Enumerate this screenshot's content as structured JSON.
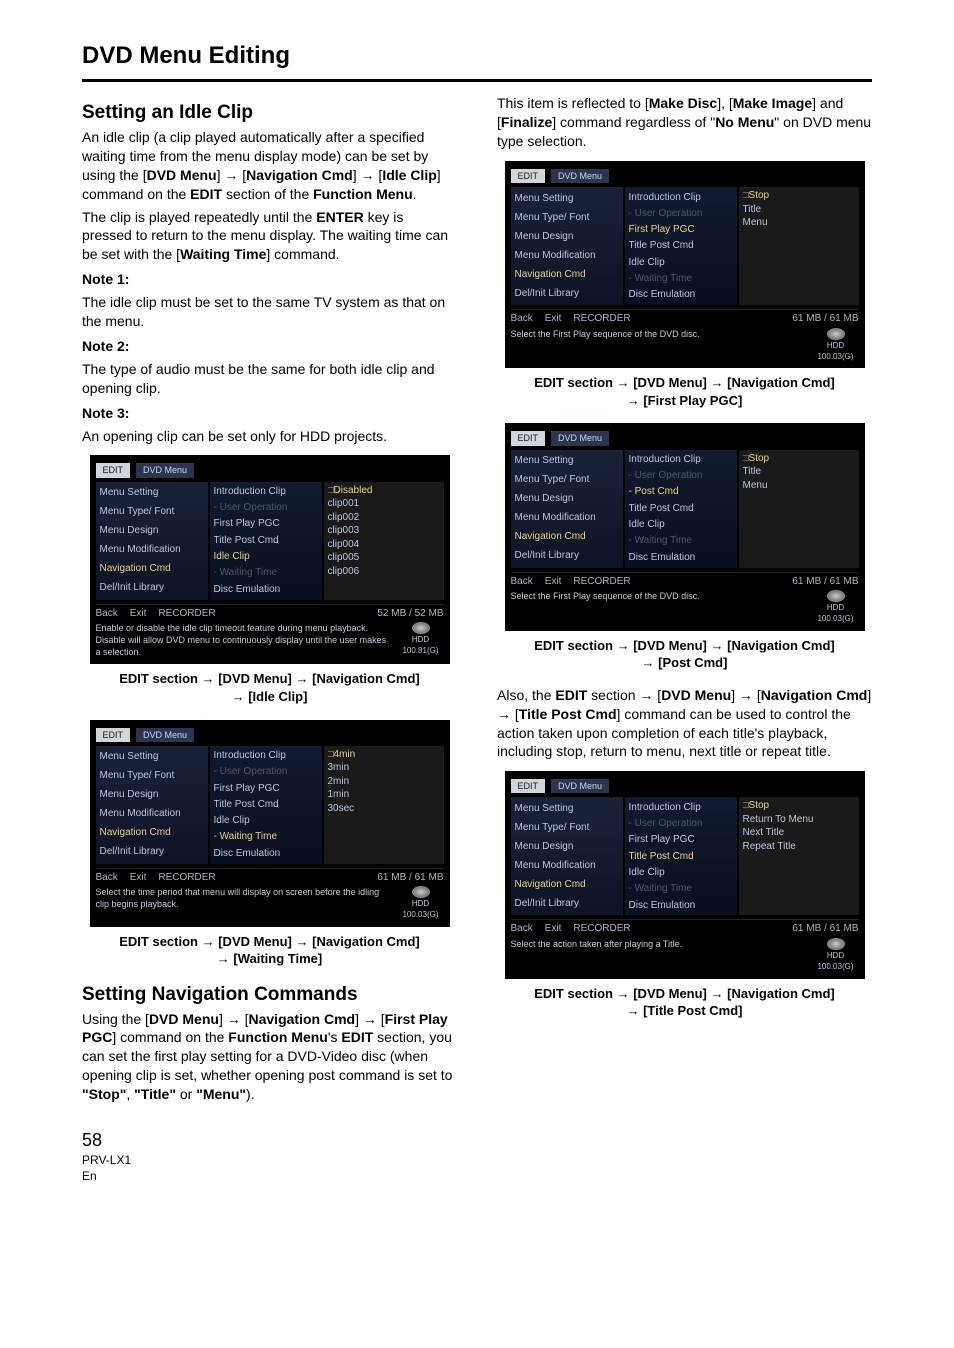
{
  "pageTitle": "DVD Menu Editing",
  "footer": {
    "page": "58",
    "model": "PRV-LX1",
    "lang": "En"
  },
  "left": {
    "h_idle": "Setting an Idle Clip",
    "idle_p1": "An idle clip (a clip played automatically after a specified waiting time from the menu display mode) can be set by using the [DVD Menu] → [Navigation Cmd] → [Idle Clip] command on the EDIT section of the Function Menu.",
    "idle_p2": "The clip is played repeatedly until the ENTER key is pressed to return to the menu display. The waiting time can be set with the [Waiting Time] command.",
    "n1h": "Note 1:",
    "n1": "The idle clip must be set to the same TV system as that on the menu.",
    "n2h": "Note 2:",
    "n2": "The type of audio must be the same for both idle clip and opening clip.",
    "n3h": "Note 3:",
    "n3": "An opening clip can be set only for HDD projects.",
    "cap1": "EDIT section → [DVD Menu] → [Navigation Cmd] → [Idle Clip]",
    "cap2": "EDIT section → [DVD Menu] → [Navigation Cmd] → [Waiting Time]",
    "h_nav": "Setting Navigation Commands",
    "nav_p": "Using the [DVD Menu] → [Navigation Cmd] → [First Play PGC] command on the Function Menu's EDIT section, you can set the first play setting for a DVD-Video disc (when opening clip is set, whether opening post command is set to \"Stop\", \"Title\" or \"Menu\")."
  },
  "right": {
    "intro": "This item is reflected to [Make Disc], [Make Image] and [Finalize] command regardless of \"No Menu\" on DVD menu type selection.",
    "cap1": "EDIT section → [DVD Menu] → [Navigation Cmd] → [First Play PGC]",
    "cap2": "EDIT section → [DVD Menu] → [Navigation Cmd] → [Post Cmd]",
    "mid": "Also, the EDIT section → [DVD Menu] → [Navigation Cmd] → [Title Post Cmd] command can be used to control the action taken upon completion of each title's playback, including stop, return to menu, next title or repeat title.",
    "cap3": "EDIT section → [DVD Menu] → [Navigation Cmd] → [Title Post Cmd]"
  },
  "shot_common": {
    "tab1": "EDIT",
    "tab2": "DVD Menu",
    "back": "Back",
    "exit": "Exit",
    "rec": "RECORDER",
    "panel1": [
      "Menu Setting",
      "Menu Type/ Font",
      "Menu Design",
      "Menu Modification",
      "Navigation Cmd",
      "Del/Init Library"
    ]
  },
  "shot1": {
    "panel2": [
      "Introduction Clip",
      "- User Operation",
      "First Play PGC",
      "Title Post Cmd",
      "Idle Clip",
      "- Waiting Time",
      "Disc Emulation"
    ],
    "panel3": [
      "□Disabled",
      "clip001",
      "clip002",
      "clip003",
      "clip004",
      "clip005",
      "clip006"
    ],
    "size": "52 MB /   52 MB",
    "help": "Enable or disable the idle clip timeout feature during menu playback. Disable will allow DVD menu to continuously display until the user makes a selection.",
    "hdd": "100.81(G)"
  },
  "shot2": {
    "panel2": [
      "Introduction Clip",
      "- User Operation",
      "First Play PGC",
      "Title Post Cmd",
      "Idle Clip",
      "- Waiting Time",
      "Disc Emulation"
    ],
    "panel3": [
      "□4min",
      "3min",
      "2min",
      "1min",
      "30sec"
    ],
    "size": "61 MB /   61 MB",
    "help": "Select the time period that menu will display on screen before the idling clip begins playback.",
    "hdd": "100.03(G)"
  },
  "shot3": {
    "panel2": [
      "Introduction Clip",
      "- User Operation",
      "First Play PGC",
      "Title Post Cmd",
      "Idle Clip",
      "- Waiting Time",
      "Disc Emulation"
    ],
    "panel3": [
      "□Stop",
      "Title",
      "Menu"
    ],
    "size": "61 MB /   61 MB",
    "help": "Select the First Play sequence of the DVD disc.",
    "hdd": "100.03(G)"
  },
  "shot4": {
    "panel2": [
      "Introduction Clip",
      "- User Operation",
      "- Post Cmd",
      "Title Post Cmd",
      "Idle Clip",
      "- Waiting Time",
      "Disc Emulation"
    ],
    "panel3": [
      "□Stop",
      "Title",
      "Menu"
    ],
    "size": "61 MB /   61 MB",
    "help": "Select the First Play sequence of the DVD disc.",
    "hdd": "100.03(G)"
  },
  "shot5": {
    "panel2": [
      "Introduction Clip",
      "- User Operation",
      "First Play PGC",
      "Title Post Cmd",
      "Idle Clip",
      "- Waiting Time",
      "Disc Emulation"
    ],
    "panel3": [
      "□Stop",
      "Return To Menu",
      "Next Title",
      "Repeat Title"
    ],
    "size": "61 MB /   61 MB",
    "help": "Select the action taken after playing a Title.",
    "hdd": "100.03(G)"
  }
}
